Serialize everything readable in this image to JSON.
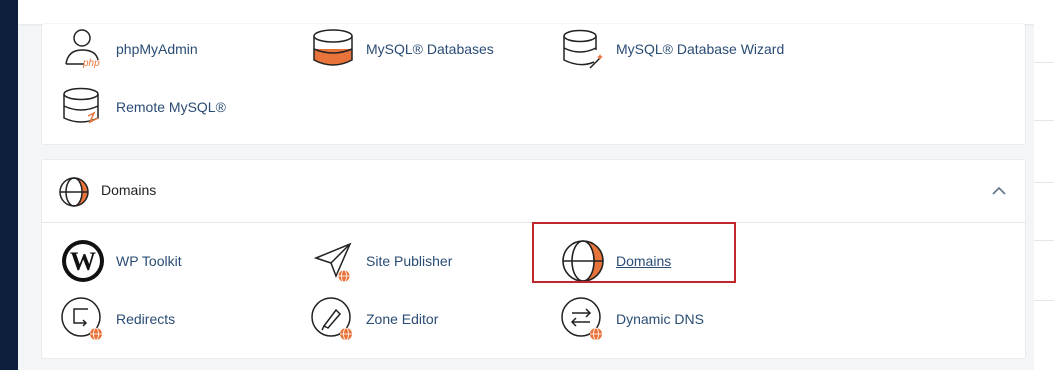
{
  "colors": {
    "accent": "#e8743b",
    "link": "#2a4c74",
    "highlight_border": "#c0272d",
    "sidebar": "#0d1f3c"
  },
  "databases": {
    "items": [
      {
        "label": "phpMyAdmin",
        "icon": "phpmyadmin-icon"
      },
      {
        "label": "MySQL® Databases",
        "icon": "mysql-databases-icon"
      },
      {
        "label": "MySQL® Database Wizard",
        "icon": "mysql-wizard-icon"
      },
      {
        "label": "Remote MySQL®",
        "icon": "remote-mysql-icon"
      }
    ]
  },
  "domains": {
    "title": "Domains",
    "items": [
      {
        "label": "WP Toolkit",
        "icon": "wordpress-icon"
      },
      {
        "label": "Site Publisher",
        "icon": "site-publisher-icon"
      },
      {
        "label": "Domains",
        "icon": "domains-globe-icon"
      },
      {
        "label": "Redirects",
        "icon": "redirects-icon"
      },
      {
        "label": "Zone Editor",
        "icon": "zone-editor-icon"
      },
      {
        "label": "Dynamic DNS",
        "icon": "dynamic-dns-icon"
      }
    ]
  }
}
